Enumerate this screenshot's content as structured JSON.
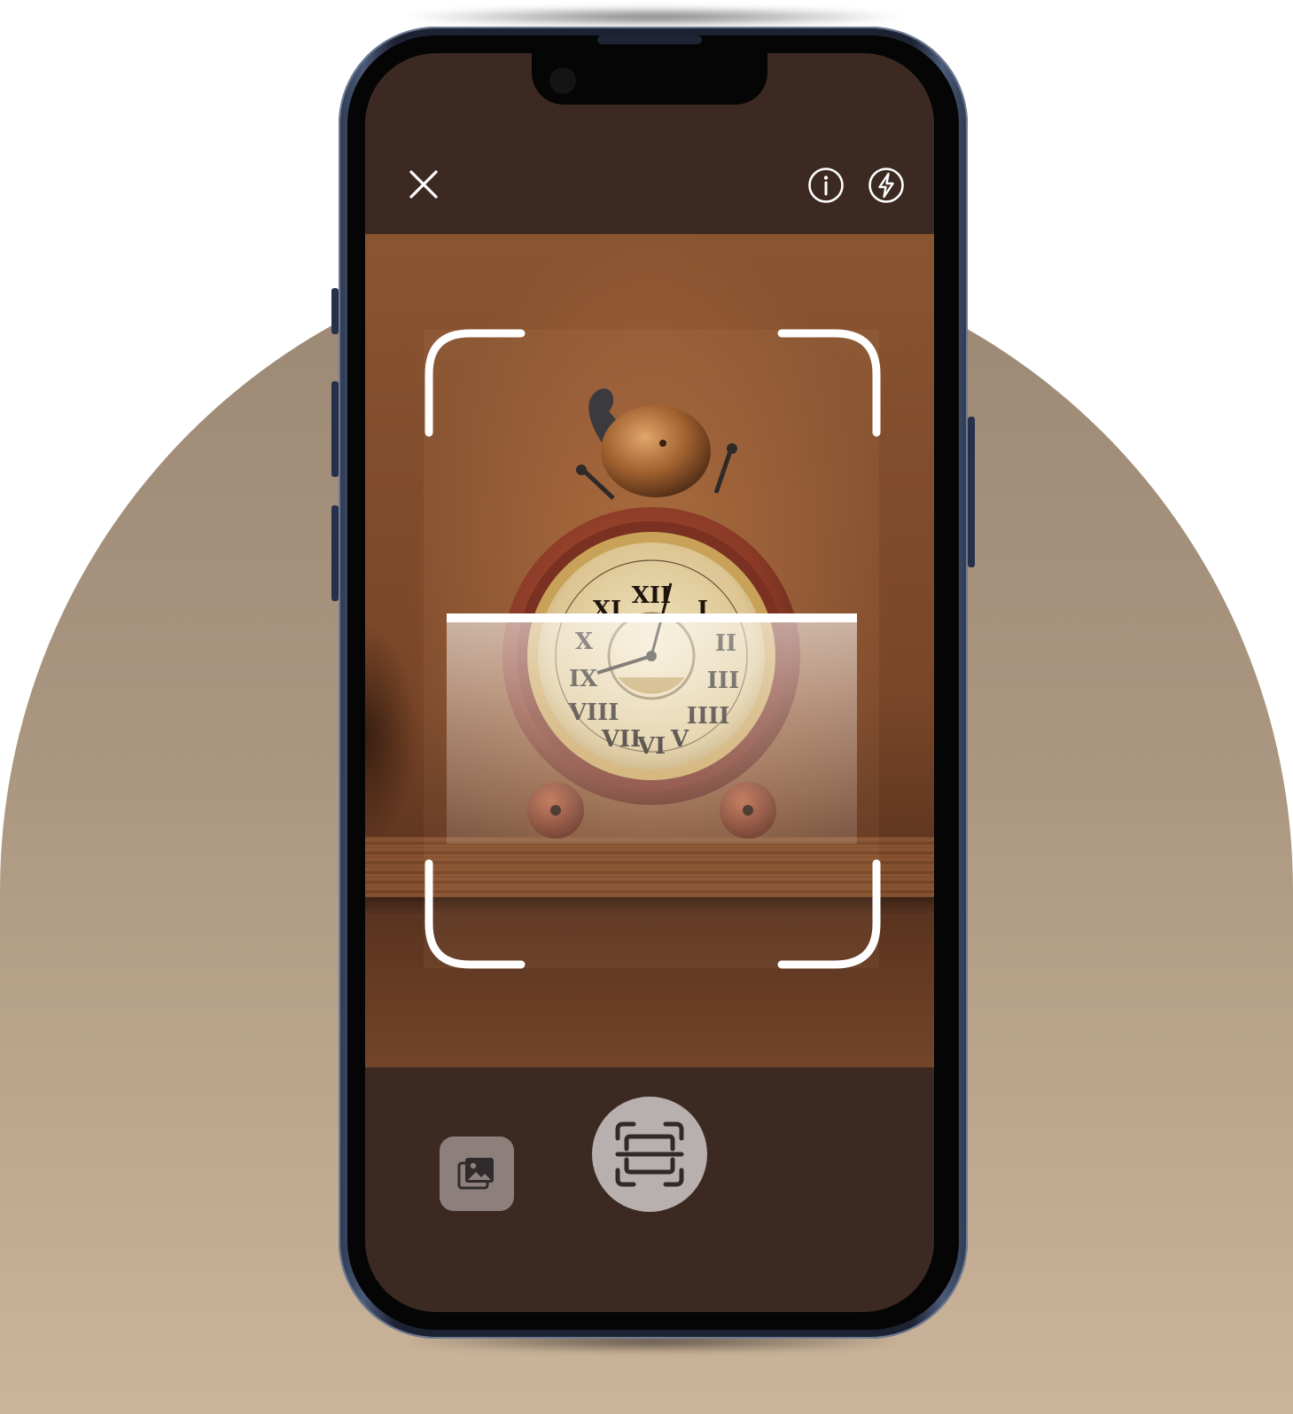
{
  "colors": {
    "screen_background": "#3c2a22",
    "arch_top": "#9b8874",
    "arch_bottom": "#cbb49a",
    "scan_line": "#ffffff",
    "gallery_button": "#8d807c",
    "scan_button": "#b7b0ae",
    "icon_color": "#ffffff"
  },
  "top_bar": {
    "left_icon": "close-icon",
    "right_icons": [
      "info-icon",
      "flash-icon"
    ]
  },
  "camera_view": {
    "subject": "antique alarm clock on wooden shelf",
    "overlay": "scan-frame-corners",
    "scanning": true
  },
  "bottom_bar": {
    "gallery_icon": "gallery-icon",
    "capture_icon": "scan-icon"
  }
}
